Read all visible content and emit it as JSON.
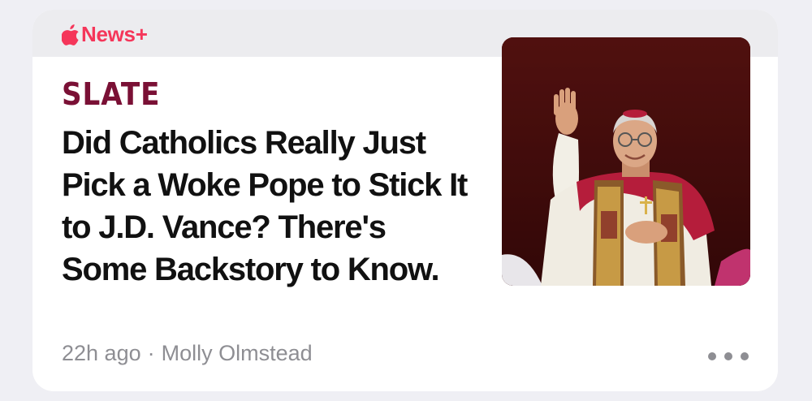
{
  "app": {
    "brand_label": "News+",
    "brand_color": "#f5365a",
    "brand_icon": "apple-logo-icon"
  },
  "article": {
    "publisher": "SLATE",
    "publisher_color": "#7a1035",
    "headline_lines": [
      "Did Catholics Really Just",
      "Pick a Woke Pope to Stick It",
      "to J.D. Vance? There's",
      "Some Backstory to Know."
    ],
    "age": "22h ago",
    "separator": "·",
    "author": "Molly Olmstead",
    "thumbnail_icon": "photo-thumbnail"
  },
  "actions": {
    "more_icon": "ellipsis-icon"
  }
}
